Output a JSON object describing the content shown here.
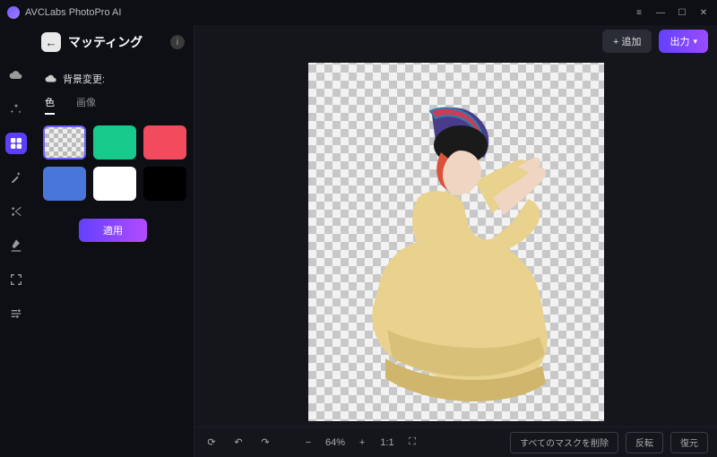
{
  "titlebar": {
    "app_name": "AVCLabs PhotoPro AI"
  },
  "header": {
    "add_label": "+ 追加",
    "output_label": "出力"
  },
  "sidebar": {
    "title": "マッティング",
    "section_label": "背景変更:",
    "tabs": {
      "color": "色",
      "image": "画像"
    },
    "swatches": [
      {
        "name": "transparent",
        "class": "transparent",
        "style": ""
      },
      {
        "name": "green",
        "class": "",
        "style": "background:#17c98a"
      },
      {
        "name": "red",
        "class": "",
        "style": "background:#f24b5d"
      },
      {
        "name": "blue",
        "class": "",
        "style": "background:#4977d9"
      },
      {
        "name": "white",
        "class": "",
        "style": "background:#ffffff"
      },
      {
        "name": "black",
        "class": "",
        "style": "background:#000000"
      }
    ],
    "apply_label": "適用"
  },
  "footer": {
    "zoom_pct": "64%",
    "ratio_label": "1:1",
    "delete_masks": "すべてのマスクを削除",
    "invert": "反転",
    "restore": "復元"
  }
}
